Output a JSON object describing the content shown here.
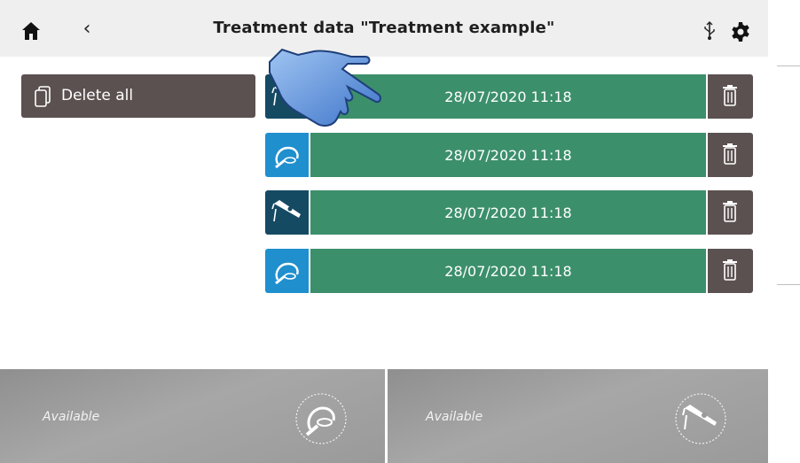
{
  "header": {
    "title": "Treatment data \"Treatment example\"",
    "home_icon": "home-icon",
    "back_icon": "chevron-left-icon",
    "usb_icon": "usb-icon",
    "settings_icon": "gear-icon"
  },
  "actions": {
    "delete_all_label": "Delete all"
  },
  "treatments": [
    {
      "device": "handpiece",
      "timestamp": "28/07/2020 11:18"
    },
    {
      "device": "headset",
      "timestamp": "28/07/2020 11:18"
    },
    {
      "device": "handpiece",
      "timestamp": "28/07/2020 11:18"
    },
    {
      "device": "headset",
      "timestamp": "28/07/2020 11:18"
    }
  ],
  "slots": [
    {
      "status": "Available",
      "device": "headset"
    },
    {
      "status": "Available",
      "device": "handpiece"
    }
  ],
  "colors": {
    "row_bar": "#3c8f6b",
    "trash": "#5b5150",
    "device_dark": "#154a63",
    "device_blue": "#1f8fce"
  }
}
